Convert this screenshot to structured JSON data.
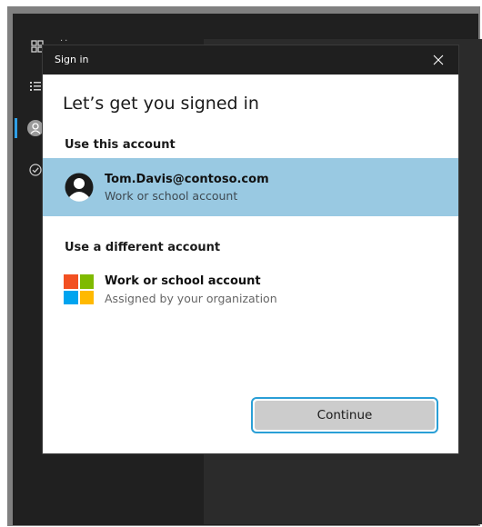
{
  "dialog": {
    "title": "Sign in",
    "heading": "Let’s get you signed in"
  },
  "use_account": {
    "section_label": "Use this account",
    "name": "Tom.Davis@contoso.com",
    "type": "Work or school account"
  },
  "different_account": {
    "section_label": "Use a different account",
    "name": "Work or school account",
    "subtitle": "Assigned by your organization"
  },
  "buttons": {
    "continue_label": "Continue"
  },
  "colors": {
    "selected_row": "#99c9e2",
    "focus_ring": "#2a9fd6",
    "ms_red": "#f25022",
    "ms_green": "#7fba00",
    "ms_blue": "#00a4ef",
    "ms_yellow": "#ffb900"
  },
  "icons": [
    "grid-icon",
    "list-icon",
    "person-icon",
    "checkmark-icon",
    "close-icon",
    "avatar-icon",
    "microsoft-logo"
  ]
}
